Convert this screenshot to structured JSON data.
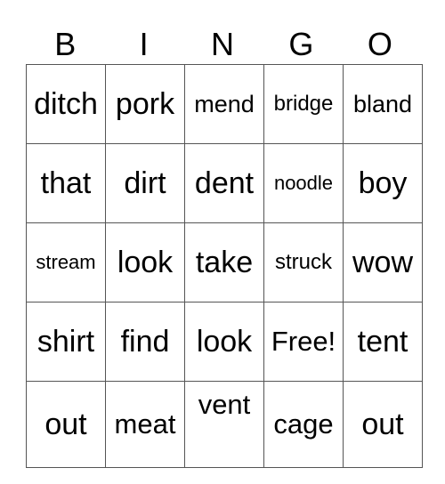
{
  "header": [
    "B",
    "I",
    "N",
    "G",
    "O"
  ],
  "card": [
    [
      "ditch",
      "pork",
      "mend",
      "bridge",
      "bland"
    ],
    [
      "that",
      "dirt",
      "dent",
      "noodle",
      "boy"
    ],
    [
      "stream",
      "look",
      "take",
      "struck",
      "wow"
    ],
    [
      "shirt",
      "find",
      "look",
      "Free!",
      "tent"
    ],
    [
      "out",
      "meat",
      "vent",
      "cage",
      "out"
    ]
  ]
}
